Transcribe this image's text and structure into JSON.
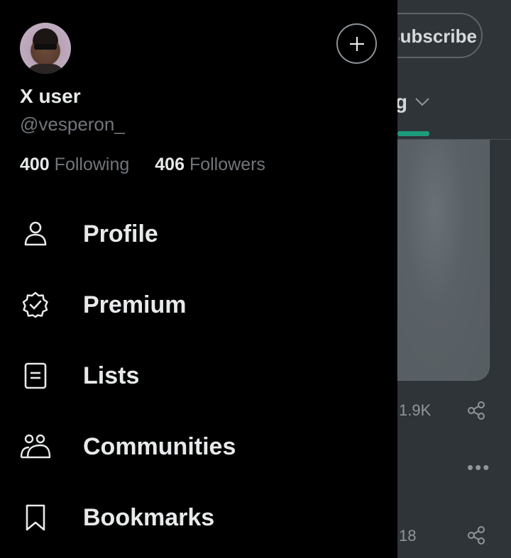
{
  "drawer": {
    "display_name": "X user",
    "handle": "@vesperon_",
    "following_count": "400",
    "following_label": "Following",
    "followers_count": "406",
    "followers_label": "Followers",
    "nav": [
      {
        "label": "Profile",
        "icon": "person-icon"
      },
      {
        "label": "Premium",
        "icon": "verified-badge-icon"
      },
      {
        "label": "Lists",
        "icon": "list-icon"
      },
      {
        "label": "Communities",
        "icon": "communities-icon"
      },
      {
        "label": "Bookmarks",
        "icon": "bookmark-icon"
      }
    ]
  },
  "background": {
    "subscribe_label": "Subscribe",
    "tab_label": "Following",
    "stat_1": "1.9K",
    "stat_2": "18"
  },
  "colors": {
    "drawer_bg": "#000000",
    "text_primary": "#e7e9ea",
    "text_secondary": "#71767b",
    "accent_indicator": "#1d9b7c"
  }
}
